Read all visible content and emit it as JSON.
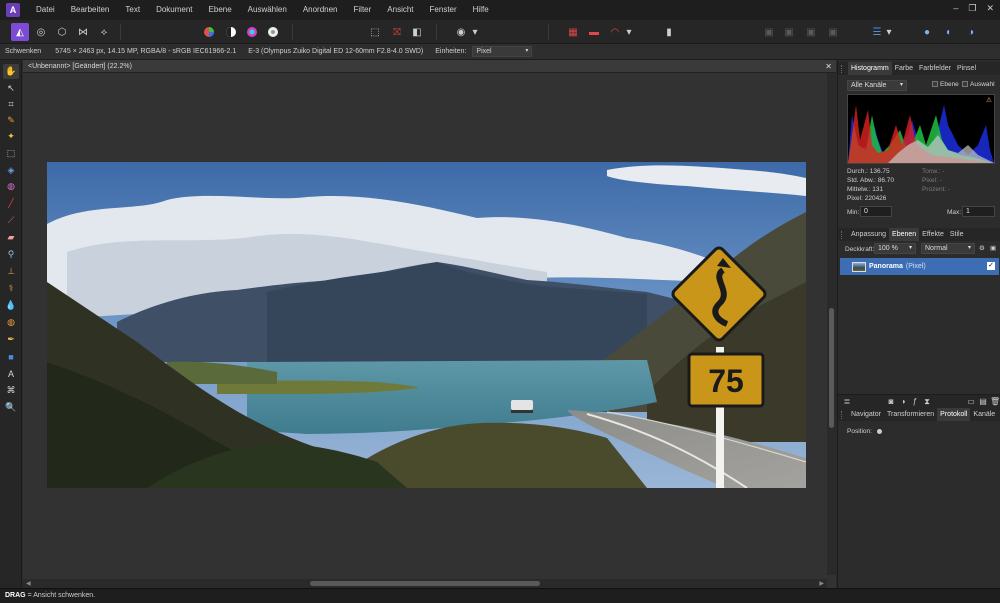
{
  "menu": {
    "logo": "A",
    "items": [
      "Datei",
      "Bearbeiten",
      "Text",
      "Dokument",
      "Ebene",
      "Auswählen",
      "Anordnen",
      "Filter",
      "Ansicht",
      "Fenster",
      "Hilfe"
    ]
  },
  "window_controls": {
    "minimize": "–",
    "restore": "❐",
    "close": "✕"
  },
  "toolbar": {
    "personas": [
      "photo-persona-icon",
      "liquify-persona-icon",
      "develop-persona-icon",
      "tone-mapping-persona-icon",
      "export-persona-icon"
    ],
    "accent": "#7c4cd6"
  },
  "context_bar": {
    "tool_label": "Schwenken",
    "image_info": "5745 × 2463 px, 14.15 MP, RGBA/8 - sRGB IEC61966-2.1",
    "camera_info": "E-3 (Olympus Zuiko Digital ED 12-60mm F2.8-4.0 SWD)",
    "units_label": "Einheiten:",
    "units_value": "Pixel"
  },
  "document": {
    "tab_title": "<Unbenannt> [Geändert] (22.2%)",
    "close": "✕"
  },
  "panels": {
    "top_tabs": [
      "Histogramm",
      "Farbe",
      "Farbfelder",
      "Pinsel"
    ],
    "histogram": {
      "channel": "Alle Kanäle",
      "layer_option": "Ebene",
      "selection_option": "Auswahl",
      "warning": "⚠",
      "stats_left": [
        {
          "label": "Durch.:",
          "value": "136.75"
        },
        {
          "label": "Std. Abw.:",
          "value": "86.70"
        },
        {
          "label": "Mittelw.:",
          "value": "131"
        },
        {
          "label": "Pixel:",
          "value": "220426"
        }
      ],
      "stats_right": [
        {
          "label": "Tonw.:",
          "value": "-"
        },
        {
          "label": "Pixel:",
          "value": "-"
        },
        {
          "label": "Prozent:",
          "value": "-"
        }
      ],
      "min_label": "Min:",
      "min_value": "0",
      "max_label": "Max:",
      "max_value": "1"
    },
    "layer_tabs": [
      "Anpassung",
      "Ebenen",
      "Effekte",
      "Stile"
    ],
    "layers": {
      "opacity_label": "Deckkraft:",
      "opacity_value": "100 %",
      "blend_mode": "Normal",
      "layer_name": "Panorama",
      "layer_type": "(Pixel)",
      "check": "✓"
    },
    "nav_tabs": [
      "Navigator",
      "Transformieren",
      "Protokoll",
      "Kanäle"
    ],
    "navigator": {
      "position_label": "Position:"
    }
  },
  "status": {
    "key": "DRAG",
    "text": " = Ansicht schwenken."
  }
}
